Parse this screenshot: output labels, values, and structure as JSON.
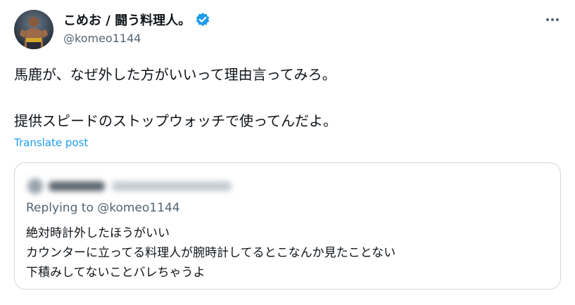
{
  "tweet": {
    "author": {
      "display_name": "こめお / 闘う料理人。",
      "handle": "@komeo1144",
      "avatar_icon": "avatar-photo",
      "verified": true
    },
    "more_icon": "more-horizontal-icon",
    "text_lines": [
      "馬鹿が、なぜ外した方がいいって理由言ってみろ。",
      "提供スピードのストップウォッチで使ってんだよ。"
    ],
    "translate_label": "Translate post",
    "colors": {
      "accent": "#1d9bf0",
      "text": "#0f1419",
      "secondary": "#536471",
      "border": "#cfd9de"
    }
  },
  "quoted": {
    "reply_prefix": "Replying to",
    "reply_handle": "@komeo1144",
    "text_lines": [
      "絶対時計外したほうがいい",
      "カウンターに立ってる料理人が腕時計してるとこなんか見たことない",
      "下積みしてないことバレちゃうよ"
    ]
  }
}
